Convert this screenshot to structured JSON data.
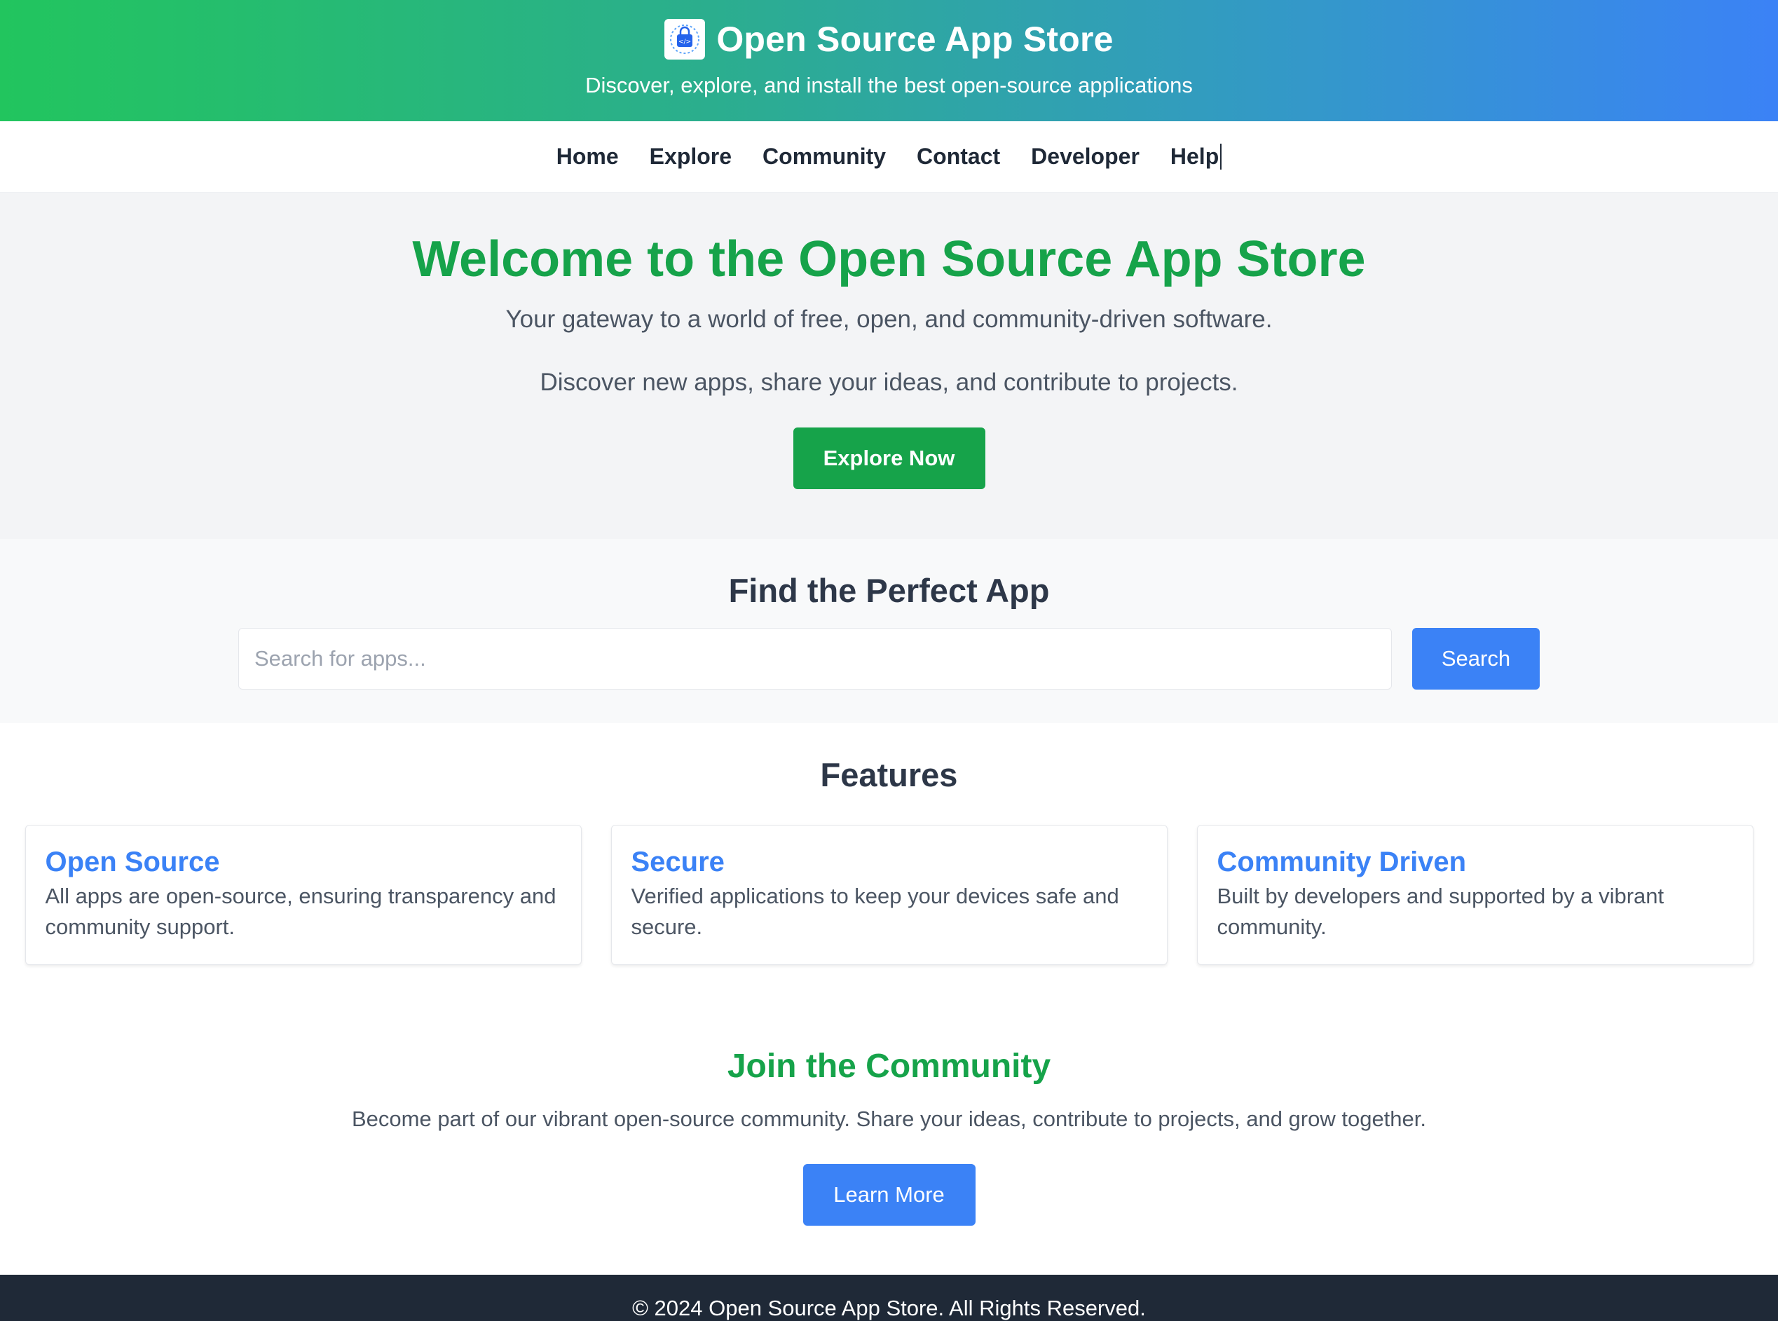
{
  "header": {
    "title": "Open Source App Store",
    "subtitle": "Discover, explore, and install the best open-source applications",
    "logo_icon": "app-store-logo-icon"
  },
  "nav": {
    "items": [
      "Home",
      "Explore",
      "Community",
      "Contact",
      "Developer",
      "Help"
    ]
  },
  "hero": {
    "title": "Welcome to the Open Source App Store",
    "line1": "Your gateway to a world of free, open, and community-driven software.",
    "line2": "Discover new apps, share your ideas, and contribute to projects.",
    "button": "Explore Now"
  },
  "search": {
    "title": "Find the Perfect App",
    "placeholder": "Search for apps...",
    "value": "",
    "button": "Search"
  },
  "features": {
    "title": "Features",
    "cards": [
      {
        "title": "Open Source",
        "text": "All apps are open-source, ensuring transparency and community support."
      },
      {
        "title": "Secure",
        "text": "Verified applications to keep your devices safe and secure."
      },
      {
        "title": "Community Driven",
        "text": "Built by developers and supported by a vibrant community."
      }
    ]
  },
  "community": {
    "title": "Join the Community",
    "text": "Become part of our vibrant open-source community. Share your ideas, contribute to projects, and grow together.",
    "button": "Learn More"
  },
  "footer": {
    "text": "© 2024 Open Source App Store. All Rights Reserved."
  },
  "colors": {
    "green": "#16a34a",
    "blue": "#3b82f6",
    "footer_bg": "#1f2937"
  }
}
